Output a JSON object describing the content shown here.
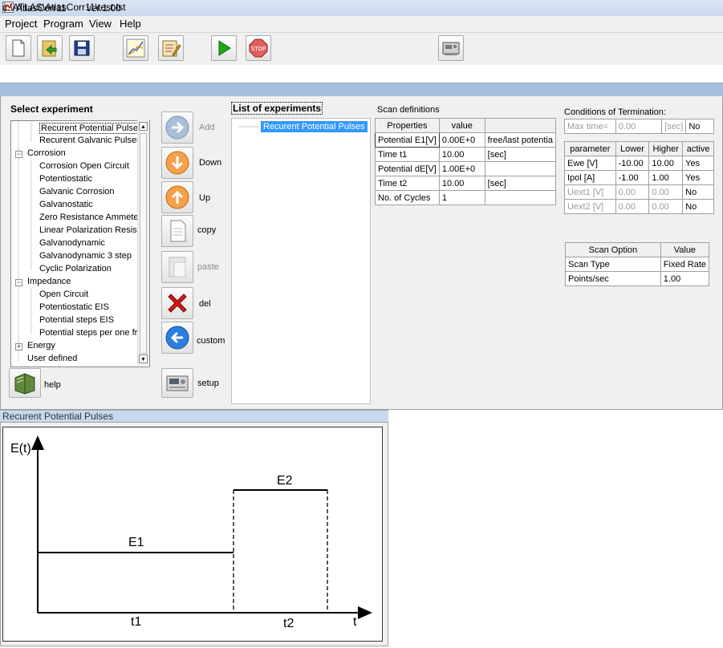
{
  "window": {
    "app_name": "AtlasCorr11",
    "version": "ver.1.00"
  },
  "menu": [
    "Project",
    "Program",
    "View",
    "Help"
  ],
  "toolbar": [
    "new-icon",
    "open-icon",
    "save-icon",
    "chart-icon",
    "edit-icon",
    "run-icon",
    "stop-icon",
    "device-icon"
  ],
  "path": "c:\\ATLAS\\AtlasCorr11\\test.lst",
  "select_experiment_label": "Select experiment",
  "tree": {
    "nodes": [
      {
        "label": "Recurent Potential Pulses",
        "level": 1,
        "selected": true
      },
      {
        "label": "Recurent Galvanic Pulses",
        "level": 1
      },
      {
        "label": "Corrosion",
        "level": 0,
        "toggle": "−"
      },
      {
        "label": "Corrosion Open Circuit",
        "level": 1
      },
      {
        "label": "Potentiostatic",
        "level": 1
      },
      {
        "label": "Galvanic Corrosion",
        "level": 1
      },
      {
        "label": "Galvanostatic",
        "level": 1
      },
      {
        "label": "Zero Resistance Ammeter",
        "level": 1
      },
      {
        "label": "Linear Polarization Resista",
        "level": 1
      },
      {
        "label": "Galvanodynamic",
        "level": 1
      },
      {
        "label": "Galvanodynamic 3 step",
        "level": 1
      },
      {
        "label": "Cyclic Polarization",
        "level": 1
      },
      {
        "label": "Impedance",
        "level": 0,
        "toggle": "−"
      },
      {
        "label": "Open Circuit",
        "level": 1
      },
      {
        "label": "Potentiostatic EIS",
        "level": 1
      },
      {
        "label": "Potential steps EIS",
        "level": 1
      },
      {
        "label": "Potential steps per one fre",
        "level": 1
      },
      {
        "label": "Energy",
        "level": 0,
        "toggle": "+"
      },
      {
        "label": "User defined",
        "level": 0
      }
    ]
  },
  "help_label": "help",
  "side_buttons": {
    "add": "Add",
    "down": "Down",
    "up": "Up",
    "copy": "copy",
    "paste": "paste",
    "del": "del",
    "custom": "custom",
    "setup": "setup"
  },
  "list_of_experiments": {
    "label": "List of experiments",
    "items": [
      "Recurent Potential Pulses"
    ]
  },
  "scan_definitions": {
    "label": "Scan definitions",
    "headers": [
      "Properties",
      "value",
      ""
    ],
    "rows": [
      [
        "Potential E1[V]",
        "0.00E+0",
        "free/last potentia"
      ],
      [
        "Time t1",
        "10.00",
        "[sec]"
      ],
      [
        "Potential dE[V]",
        "1.00E+0",
        ""
      ],
      [
        "Time t2",
        "10.00",
        "[sec]"
      ],
      [
        "No. of Cycles",
        "1",
        ""
      ]
    ]
  },
  "termination": {
    "label": "Conditions of Termination:",
    "max_time": [
      "Max time=",
      "0.00",
      "[sec]",
      "No"
    ],
    "headers": [
      "parameter",
      "Lower",
      "Higher",
      "active"
    ],
    "rows": [
      [
        "Ewe [V]",
        "-10.00",
        "10.00",
        "Yes"
      ],
      [
        "Ipol [A]",
        "-1.00",
        "1.00",
        "Yes"
      ],
      [
        "Uext1 [V]",
        "0.00",
        "0.00",
        "No"
      ],
      [
        "Uext2 [V]",
        "0.00",
        "0.00",
        "No"
      ]
    ]
  },
  "scan_option": {
    "headers": [
      "Scan Option",
      "Value"
    ],
    "rows": [
      [
        "Scan Type",
        "Fixed Rate"
      ],
      [
        "Points/sec",
        "1.00"
      ]
    ]
  },
  "diagram": {
    "title": "Recurent Potential Pulses",
    "y_axis": "E(t)",
    "x_axis": "t",
    "e1": "E1",
    "e2": "E2",
    "t1": "t1",
    "t2": "t2"
  }
}
